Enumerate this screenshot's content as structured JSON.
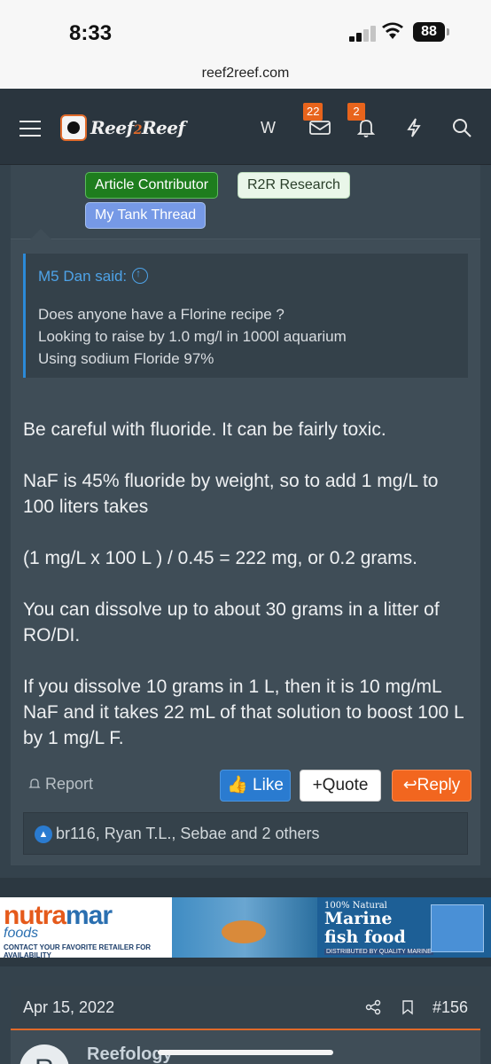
{
  "status_bar": {
    "time": "8:33",
    "battery": "88"
  },
  "browser": {
    "url": "reef2reef.com"
  },
  "nav": {
    "logo_text_1": "Reef",
    "logo_text_2": "2",
    "logo_text_3": "Reef",
    "user_initial": "W",
    "inbox_count": "22",
    "alerts_count": "2"
  },
  "prev_post": {
    "tags": [
      "Article Contributor",
      "R2R Research",
      "My Tank Thread"
    ]
  },
  "post": {
    "quote": {
      "author": "M5 Dan said:",
      "lines": [
        "Does anyone have a Florine recipe ?",
        "Looking to raise by 1.0 mg/l in 1000l aquarium",
        "Using sodium Floride 97%"
      ]
    },
    "paragraphs": [
      "Be careful with fluoride. It can be fairly toxic.",
      "NaF is 45% fluoride by weight, so to add 1 mg/L to 100 liters takes",
      "(1 mg/L x 100 L ) / 0.45 = 222 mg, or 0.2 grams.",
      "You can dissolve up to about 30 grams in a litter of RO/DI.",
      "If you dissolve 10 grams in 1 L, then it is 10 mg/mL NaF and it takes 22 mL of that solution to boost 100 L by 1 mg/L F."
    ],
    "report_label": "Report",
    "like_label": "Like",
    "quote_label": "Quote",
    "reply_label": "Reply",
    "likes_text": "br116, Ryan T.L., Sebae and 2 others"
  },
  "ad": {
    "brand_1": "nutra",
    "brand_2": "mar",
    "brand_sub": "foods",
    "cta": "CONTACT YOUR FAVORITE RETAILER FOR AVAILABILITY",
    "tagline_small": "100% Natural",
    "tagline_big_1": "Marine",
    "tagline_big_2": "fish food",
    "distributed": "DISTRIBUTED BY QUALITY MARINE"
  },
  "next_post": {
    "date": "Apr 15, 2022",
    "number": "#156",
    "author": "Reefology",
    "avatar_letter": "R"
  },
  "colors": {
    "page_bg": "#34424c",
    "post_bg": "#3f4d57",
    "accent_orange": "#f2661f",
    "link_blue": "#4ea3e8",
    "like_blue": "#2a7bd0"
  }
}
